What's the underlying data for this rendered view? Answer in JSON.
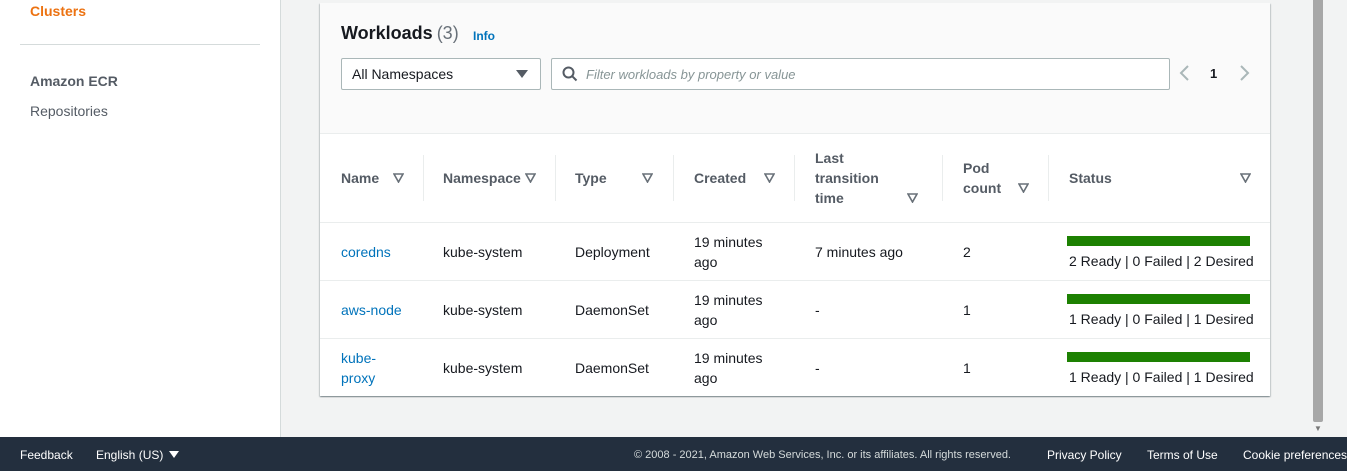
{
  "sidebar": {
    "clusters_label": "Clusters",
    "section_heading": "Amazon ECR",
    "repositories_label": "Repositories"
  },
  "workloads": {
    "title": "Workloads",
    "count": "(3)",
    "info_label": "Info",
    "namespace_select_value": "All Namespaces",
    "filter_placeholder": "Filter workloads by property or value",
    "current_page": "1",
    "columns": {
      "name": "Name",
      "namespace": "Namespace",
      "type": "Type",
      "created": "Created",
      "last_transition_line1": "Last",
      "last_transition_line2": "transition",
      "last_transition_line3": "time",
      "pod_count_line1": "Pod",
      "pod_count_line2": "count",
      "status": "Status"
    },
    "rows": [
      {
        "name_line1": "coredns",
        "name_line2": "",
        "namespace": "kube-system",
        "type": "Deployment",
        "created_line1": "19 minutes",
        "created_line2": "ago",
        "last_transition": "7 minutes ago",
        "pod_count": "2",
        "status": "2 Ready | 0 Failed | 2 Desired",
        "ready_fraction": 1.0
      },
      {
        "name_line1": "aws-node",
        "name_line2": "",
        "namespace": "kube-system",
        "type": "DaemonSet",
        "created_line1": "19 minutes",
        "created_line2": "ago",
        "last_transition": "-",
        "pod_count": "1",
        "status": "1 Ready | 0 Failed | 1 Desired",
        "ready_fraction": 1.0
      },
      {
        "name_line1": "kube-",
        "name_line2": "proxy",
        "namespace": "kube-system",
        "type": "DaemonSet",
        "created_line1": "19 minutes",
        "created_line2": "ago",
        "last_transition": "-",
        "pod_count": "1",
        "status": "1 Ready | 0 Failed | 1 Desired",
        "ready_fraction": 1.0
      }
    ]
  },
  "footer": {
    "feedback": "Feedback",
    "language": "English (US)",
    "copyright": "© 2008 - 2021, Amazon Web Services, Inc. or its affiliates. All rights reserved.",
    "privacy": "Privacy Policy",
    "terms": "Terms of Use",
    "cookies": "Cookie preferences"
  },
  "colors": {
    "accent_orange": "#ec7211",
    "link_blue": "#0073bb",
    "status_green": "#1d8102",
    "footer_bg": "#232f3e"
  },
  "icons": [
    "search-icon",
    "chevron-down-icon",
    "sort-down-icon",
    "chevron-left-icon",
    "chevron-right-icon"
  ]
}
